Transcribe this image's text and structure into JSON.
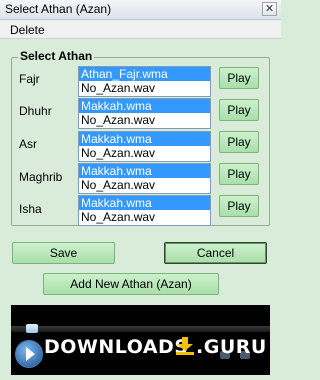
{
  "window": {
    "title": "Select Athan (Azan)",
    "close_glyph": "✕"
  },
  "menu": {
    "delete_label": "Delete"
  },
  "group": {
    "legend": "Select Athan"
  },
  "prayers": [
    {
      "label": "Fajr",
      "options": [
        "Athan_Fajr.wma",
        "No_Azan.wav"
      ],
      "selected": 0,
      "play_label": "Play"
    },
    {
      "label": "Dhuhr",
      "options": [
        "Makkah.wma",
        "No_Azan.wav"
      ],
      "selected": 0,
      "play_label": "Play"
    },
    {
      "label": "Asr",
      "options": [
        "Makkah.wma",
        "No_Azan.wav"
      ],
      "selected": 0,
      "play_label": "Play"
    },
    {
      "label": "Maghrib",
      "options": [
        "Makkah.wma",
        "No_Azan.wav"
      ],
      "selected": 0,
      "play_label": "Play"
    },
    {
      "label": "Isha",
      "options": [
        "Makkah.wma",
        "No_Azan.wav"
      ],
      "selected": 0,
      "play_label": "Play"
    }
  ],
  "buttons": {
    "save": "Save",
    "cancel": "Cancel",
    "add_new": "Add New Athan (Azan)"
  },
  "player": {
    "watermark": "DOWNLOADS",
    "watermark_suffix": ".GURU"
  },
  "colors": {
    "background": "#d9ecd9",
    "selection": "#3399ff",
    "button": "#b9e8b9"
  }
}
